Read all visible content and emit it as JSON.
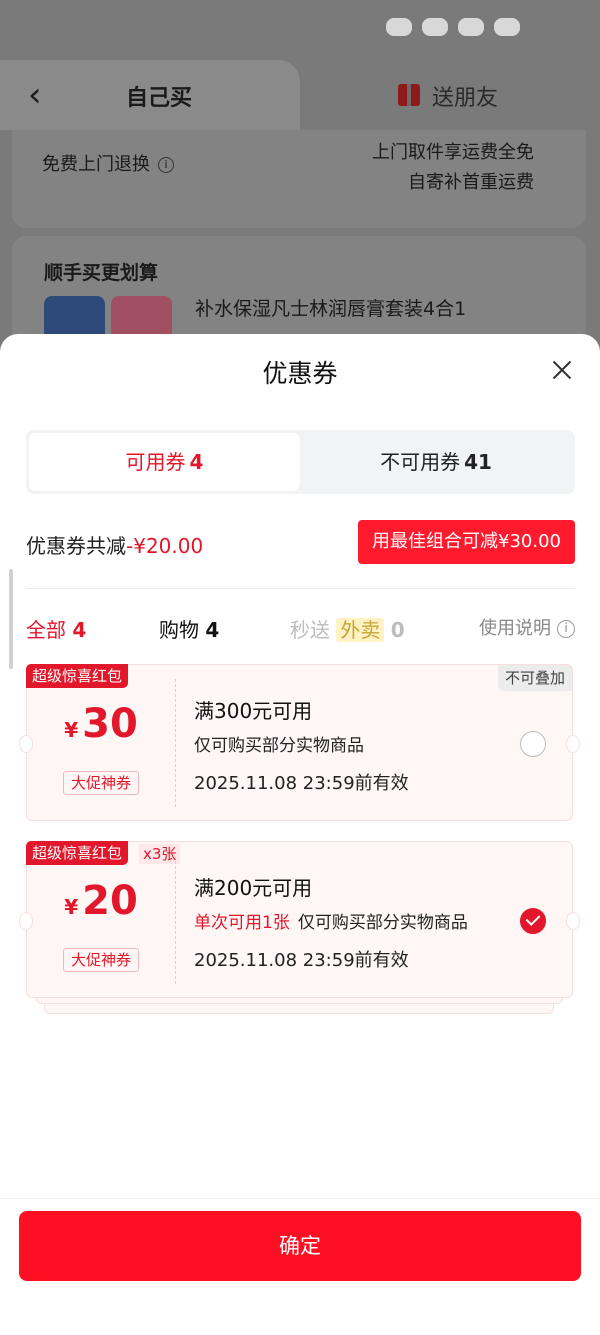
{
  "background": {
    "tab_self": "自己买",
    "tab_gift": "送朋友",
    "free_return": "免费上门退换",
    "shipping_line1": "上门取件享运费全免",
    "shipping_line2": "自寄补首重运费",
    "better_deal": "顺手买更划算",
    "product_name": "补水保湿凡士林润唇膏套装4合1"
  },
  "sheet": {
    "title": "优惠券",
    "tabs": {
      "available_label": "可用券",
      "available_count": "4",
      "unavailable_label": "不可用券",
      "unavailable_count": "41"
    },
    "total_reduce_label": "优惠券共减",
    "total_reduce_amount": "-¥20.00",
    "best_combo_button": "用最佳组合可减¥30.00",
    "filters": {
      "all_label": "全部",
      "all_count": "4",
      "shopping_label": "购物",
      "shopping_count": "4",
      "flash_label": "秒送",
      "takeout_label": "外卖",
      "flash_count": "0",
      "help_label": "使用说明"
    },
    "coupons": [
      {
        "tag": "超级惊喜红包",
        "corner": "不可叠加",
        "currency": "¥",
        "amount": "30",
        "promo_label": "大促神券",
        "condition": "满300元可用",
        "description": "仅可购买部分实物商品",
        "expiry": "2025.11.08 23:59前有效",
        "selected": false
      },
      {
        "tag": "超级惊喜红包",
        "quantity": "x3张",
        "currency": "¥",
        "amount": "20",
        "promo_label": "大促神券",
        "condition": "满200元可用",
        "limit_note": "单次可用1张",
        "description": "仅可购买部分实物商品",
        "expiry": "2025.11.08 23:59前有效",
        "selected": true
      }
    ],
    "confirm_button": "确定"
  },
  "colors": {
    "accent": "#e3172b",
    "button": "#ff0f24"
  }
}
